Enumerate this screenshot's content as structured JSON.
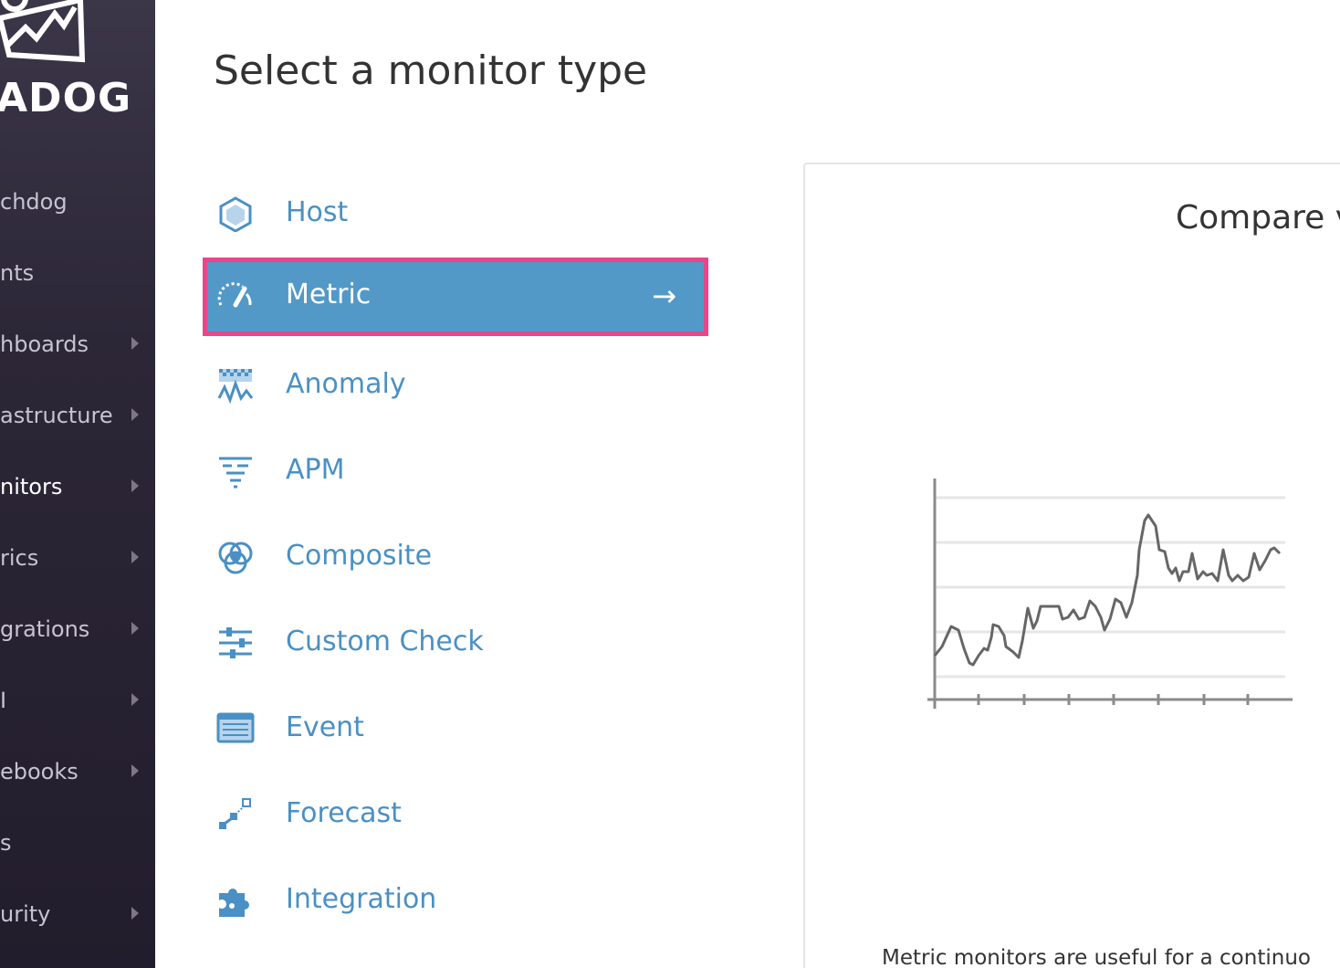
{
  "brand": {
    "logo_text": "ADOG"
  },
  "sidebar": {
    "items": [
      {
        "label": "chdog",
        "has_submenu": false,
        "active": false
      },
      {
        "label": "nts",
        "has_submenu": false,
        "active": false
      },
      {
        "label": "hboards",
        "has_submenu": true,
        "active": false
      },
      {
        "label": "astructure",
        "has_submenu": true,
        "active": false
      },
      {
        "label": "nitors",
        "has_submenu": true,
        "active": true
      },
      {
        "label": "rics",
        "has_submenu": true,
        "active": false
      },
      {
        "label": "grations",
        "has_submenu": true,
        "active": false
      },
      {
        "label": "I",
        "has_submenu": true,
        "active": false
      },
      {
        "label": "ebooks",
        "has_submenu": true,
        "active": false
      },
      {
        "label": "s",
        "has_submenu": false,
        "active": false
      },
      {
        "label": "urity",
        "has_submenu": true,
        "active": false
      }
    ]
  },
  "main": {
    "title": "Select a monitor type",
    "monitor_types": [
      {
        "label": "Host",
        "icon": "host-hexagon-icon"
      },
      {
        "label": "Metric",
        "icon": "speedometer-icon",
        "selected": true
      },
      {
        "label": "Anomaly",
        "icon": "anomaly-icon"
      },
      {
        "label": "APM",
        "icon": "apm-filter-icon"
      },
      {
        "label": "Composite",
        "icon": "composite-circles-icon"
      },
      {
        "label": "Custom Check",
        "icon": "sliders-icon"
      },
      {
        "label": "Event",
        "icon": "event-list-icon"
      },
      {
        "label": "Forecast",
        "icon": "forecast-icon"
      },
      {
        "label": "Integration",
        "icon": "puzzle-piece-icon"
      }
    ],
    "selected_arrow": "→"
  },
  "preview": {
    "title": "Compare v",
    "description": "Metric monitors are useful for a continuo"
  },
  "colors": {
    "accent": "#4a90c4",
    "selected_bg": "#5299c8",
    "selected_border": "#e8458c",
    "sidebar_bg": "#2c2737"
  }
}
